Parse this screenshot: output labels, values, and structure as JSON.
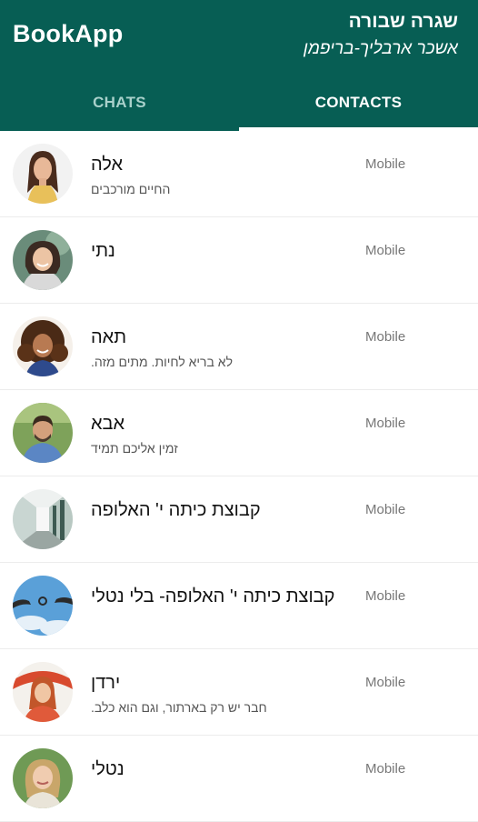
{
  "app": {
    "title": "BookApp"
  },
  "book": {
    "title": "שגרה שבורה",
    "author": "אשכר ארבליך-בריפמן"
  },
  "tabs": [
    {
      "label": "CHATS",
      "active": false
    },
    {
      "label": "CONTACTS",
      "active": true
    }
  ],
  "colors": {
    "header": "#075e54",
    "active_tab": "#ffffff",
    "inactive_tab": "#a9d1cb"
  },
  "contacts": [
    {
      "name": "אלה",
      "status": "החיים מורכבים",
      "type": "Mobile",
      "avatar": "woman-portrait-avatar"
    },
    {
      "name": "נתי",
      "status": "",
      "type": "Mobile",
      "avatar": "smiling-woman-avatar"
    },
    {
      "name": "תאה",
      "status": "לא בריא לחיות. מתים מזה.",
      "type": "Mobile",
      "avatar": "curly-hair-woman-avatar"
    },
    {
      "name": "אבא",
      "status": "זמין אליכם תמיד",
      "type": "Mobile",
      "avatar": "man-outdoors-avatar"
    },
    {
      "name": "קבוצת כיתה י' האלופה",
      "status": "",
      "type": "Mobile",
      "avatar": "school-corridor-avatar"
    },
    {
      "name": "קבוצת כיתה י' האלופה- בלי נטלי",
      "status": "",
      "type": "Mobile",
      "avatar": "sky-hands-avatar"
    },
    {
      "name": "ירדן",
      "status": "חבר יש רק בארתור, וגם הוא כלב.",
      "type": "Mobile",
      "avatar": "redhead-scarf-avatar"
    },
    {
      "name": "נטלי",
      "status": "",
      "type": "Mobile",
      "avatar": "blonde-woman-avatar"
    }
  ]
}
